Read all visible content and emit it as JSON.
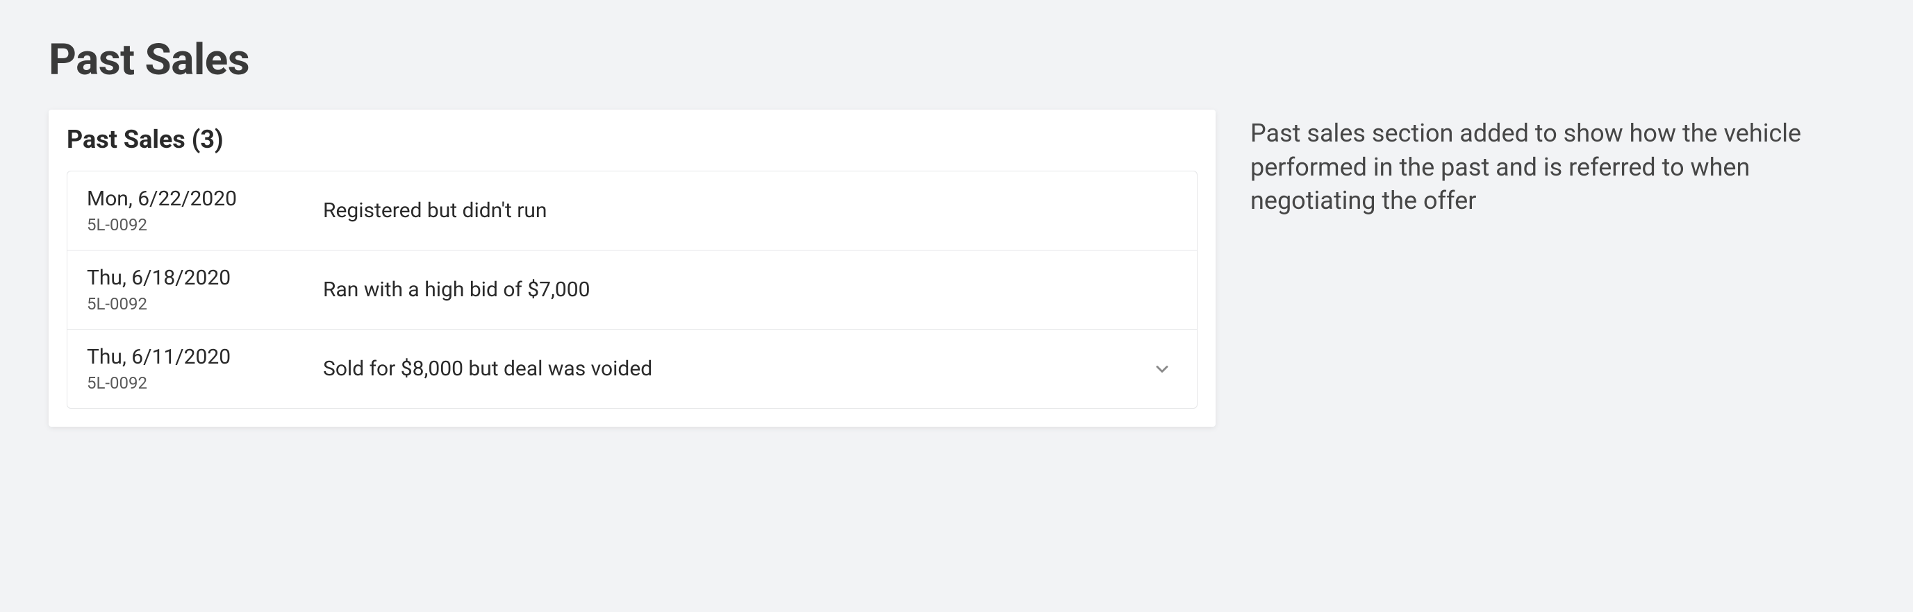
{
  "title": "Past Sales",
  "card": {
    "header": "Past Sales (3)",
    "items": [
      {
        "date": "Mon, 6/22/2020",
        "code": "5L-0092",
        "description": "Registered but didn't run",
        "expandable": false
      },
      {
        "date": "Thu, 6/18/2020",
        "code": "5L-0092",
        "description": "Ran with a high bid of $7,000",
        "expandable": false
      },
      {
        "date": "Thu, 6/11/2020",
        "code": "5L-0092",
        "description": "Sold for $8,000 but deal was voided",
        "expandable": true
      }
    ]
  },
  "annotation": "Past sales section added to show how the vehicle performed in the past and is referred to when negotiating the offer"
}
